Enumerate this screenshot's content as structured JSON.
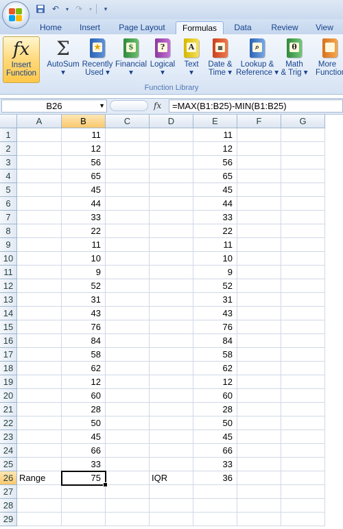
{
  "quick_access": {
    "icons": [
      "save-icon",
      "undo-icon",
      "redo-icon",
      "customize-icon"
    ]
  },
  "tabs": [
    "Home",
    "Insert",
    "Page Layout",
    "Formulas",
    "Data",
    "Review",
    "View"
  ],
  "active_tab": "Formulas",
  "ribbon": {
    "insert_function": {
      "line1": "Insert",
      "line2": "Function"
    },
    "buttons": [
      {
        "line1": "AutoSum",
        "line2": "▾"
      },
      {
        "line1": "Recently",
        "line2": "Used ▾"
      },
      {
        "line1": "Financial",
        "line2": "▾"
      },
      {
        "line1": "Logical",
        "line2": "▾"
      },
      {
        "line1": "Text",
        "line2": "▾"
      },
      {
        "line1": "Date &",
        "line2": "Time ▾"
      },
      {
        "line1": "Lookup &",
        "line2": "Reference ▾"
      },
      {
        "line1": "Math",
        "line2": "& Trig ▾"
      },
      {
        "line1": "More",
        "line2": "Function"
      }
    ],
    "group_label": "Function Library"
  },
  "formula_bar": {
    "name_box": "B26",
    "fx": "fx",
    "formula": "=MAX(B1:B25)-MIN(B1:B25)"
  },
  "columns": [
    "A",
    "B",
    "C",
    "D",
    "E",
    "F",
    "G"
  ],
  "selected_column": "B",
  "selected_row": "26",
  "rows": [
    {
      "n": "1",
      "b": "11",
      "e": "11"
    },
    {
      "n": "2",
      "b": "12",
      "e": "12"
    },
    {
      "n": "3",
      "b": "56",
      "e": "56"
    },
    {
      "n": "4",
      "b": "65",
      "e": "65"
    },
    {
      "n": "5",
      "b": "45",
      "e": "45"
    },
    {
      "n": "6",
      "b": "44",
      "e": "44"
    },
    {
      "n": "7",
      "b": "33",
      "e": "33"
    },
    {
      "n": "8",
      "b": "22",
      "e": "22"
    },
    {
      "n": "9",
      "b": "11",
      "e": "11"
    },
    {
      "n": "10",
      "b": "10",
      "e": "10"
    },
    {
      "n": "11",
      "b": "9",
      "e": "9"
    },
    {
      "n": "12",
      "b": "52",
      "e": "52"
    },
    {
      "n": "13",
      "b": "31",
      "e": "31"
    },
    {
      "n": "14",
      "b": "43",
      "e": "43"
    },
    {
      "n": "15",
      "b": "76",
      "e": "76"
    },
    {
      "n": "16",
      "b": "84",
      "e": "84"
    },
    {
      "n": "17",
      "b": "58",
      "e": "58"
    },
    {
      "n": "18",
      "b": "62",
      "e": "62"
    },
    {
      "n": "19",
      "b": "12",
      "e": "12"
    },
    {
      "n": "20",
      "b": "60",
      "e": "60"
    },
    {
      "n": "21",
      "b": "28",
      "e": "28"
    },
    {
      "n": "22",
      "b": "50",
      "e": "50"
    },
    {
      "n": "23",
      "b": "45",
      "e": "45"
    },
    {
      "n": "24",
      "b": "66",
      "e": "66"
    },
    {
      "n": "25",
      "b": "33",
      "e": "33"
    },
    {
      "n": "26",
      "a": "Range",
      "b": "75",
      "d": "IQR",
      "e": "36"
    },
    {
      "n": "27"
    },
    {
      "n": "28"
    },
    {
      "n": "29"
    }
  ],
  "colors": {
    "accent": "#15428b",
    "selected_header": "#f9c86c"
  }
}
